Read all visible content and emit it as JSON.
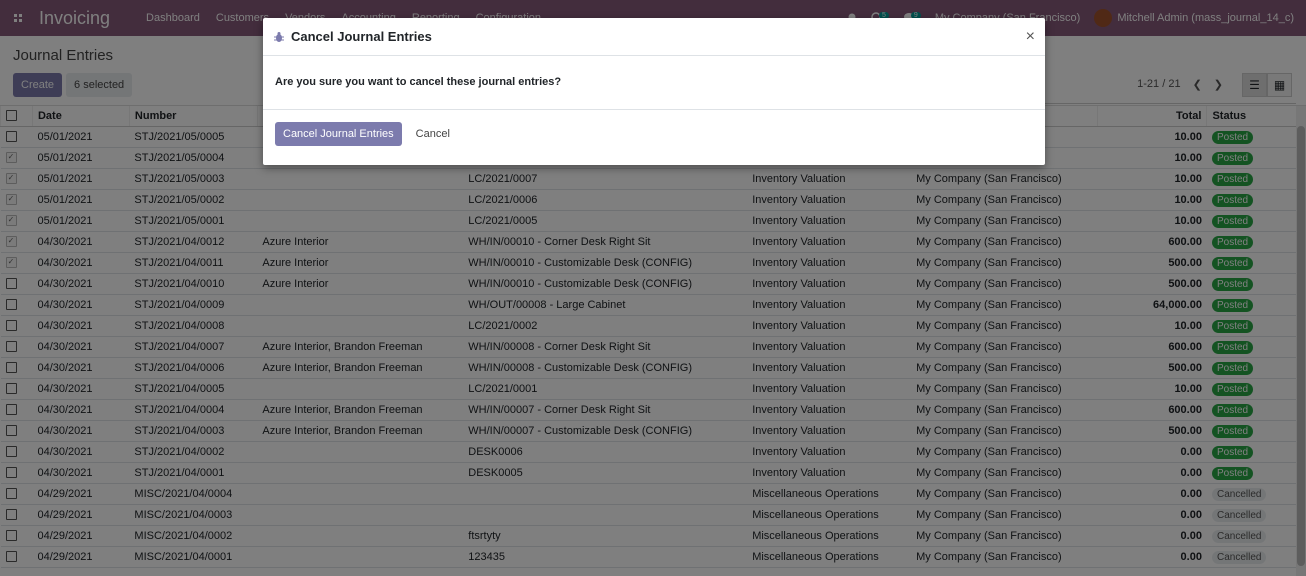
{
  "navbar": {
    "brand": "Invoicing",
    "menu": [
      "Dashboard",
      "Customers",
      "Vendors",
      "Accounting",
      "Reporting",
      "Configuration"
    ],
    "activity_count": "5",
    "messages_count": "9",
    "company": "My Company (San Francisco)",
    "user": "Mitchell Admin (mass_journal_14_c)"
  },
  "control_panel": {
    "title": "Journal Entries",
    "create_label": "Create",
    "selected_label": "6 selected",
    "pager": "1-21 / 21"
  },
  "table": {
    "headers": {
      "date": "Date",
      "number": "Number",
      "total": "Total",
      "status": "Status"
    },
    "rows": [
      {
        "checked": false,
        "date": "05/01/2021",
        "number": "STJ/2021/05/0005",
        "partner": "",
        "ref": "",
        "journal": "",
        "company": "",
        "total": "10.00",
        "status": "Posted"
      },
      {
        "checked": true,
        "date": "05/01/2021",
        "number": "STJ/2021/05/0004",
        "partner": "",
        "ref": "",
        "journal": "",
        "company": "",
        "total": "10.00",
        "status": "Posted"
      },
      {
        "checked": true,
        "date": "05/01/2021",
        "number": "STJ/2021/05/0003",
        "partner": "",
        "ref": "LC/2021/0007",
        "journal": "Inventory Valuation",
        "company": "My Company (San Francisco)",
        "total": "10.00",
        "status": "Posted"
      },
      {
        "checked": true,
        "date": "05/01/2021",
        "number": "STJ/2021/05/0002",
        "partner": "",
        "ref": "LC/2021/0006",
        "journal": "Inventory Valuation",
        "company": "My Company (San Francisco)",
        "total": "10.00",
        "status": "Posted"
      },
      {
        "checked": true,
        "date": "05/01/2021",
        "number": "STJ/2021/05/0001",
        "partner": "",
        "ref": "LC/2021/0005",
        "journal": "Inventory Valuation",
        "company": "My Company (San Francisco)",
        "total": "10.00",
        "status": "Posted"
      },
      {
        "checked": true,
        "date": "04/30/2021",
        "number": "STJ/2021/04/0012",
        "partner": "Azure Interior",
        "ref": "WH/IN/00010 - Corner Desk Right Sit",
        "journal": "Inventory Valuation",
        "company": "My Company (San Francisco)",
        "total": "600.00",
        "status": "Posted"
      },
      {
        "checked": true,
        "date": "04/30/2021",
        "number": "STJ/2021/04/0011",
        "partner": "Azure Interior",
        "ref": "WH/IN/00010 - Customizable Desk (CONFIG)",
        "journal": "Inventory Valuation",
        "company": "My Company (San Francisco)",
        "total": "500.00",
        "status": "Posted"
      },
      {
        "checked": false,
        "date": "04/30/2021",
        "number": "STJ/2021/04/0010",
        "partner": "Azure Interior",
        "ref": "WH/IN/00010 - Customizable Desk (CONFIG)",
        "journal": "Inventory Valuation",
        "company": "My Company (San Francisco)",
        "total": "500.00",
        "status": "Posted"
      },
      {
        "checked": false,
        "date": "04/30/2021",
        "number": "STJ/2021/04/0009",
        "partner": "",
        "ref": "WH/OUT/00008 - Large Cabinet",
        "journal": "Inventory Valuation",
        "company": "My Company (San Francisco)",
        "total": "64,000.00",
        "status": "Posted"
      },
      {
        "checked": false,
        "date": "04/30/2021",
        "number": "STJ/2021/04/0008",
        "partner": "",
        "ref": "LC/2021/0002",
        "journal": "Inventory Valuation",
        "company": "My Company (San Francisco)",
        "total": "10.00",
        "status": "Posted"
      },
      {
        "checked": false,
        "date": "04/30/2021",
        "number": "STJ/2021/04/0007",
        "partner": "Azure Interior, Brandon Freeman",
        "ref": "WH/IN/00008 - Corner Desk Right Sit",
        "journal": "Inventory Valuation",
        "company": "My Company (San Francisco)",
        "total": "600.00",
        "status": "Posted"
      },
      {
        "checked": false,
        "date": "04/30/2021",
        "number": "STJ/2021/04/0006",
        "partner": "Azure Interior, Brandon Freeman",
        "ref": "WH/IN/00008 - Customizable Desk (CONFIG)",
        "journal": "Inventory Valuation",
        "company": "My Company (San Francisco)",
        "total": "500.00",
        "status": "Posted"
      },
      {
        "checked": false,
        "date": "04/30/2021",
        "number": "STJ/2021/04/0005",
        "partner": "",
        "ref": "LC/2021/0001",
        "journal": "Inventory Valuation",
        "company": "My Company (San Francisco)",
        "total": "10.00",
        "status": "Posted"
      },
      {
        "checked": false,
        "date": "04/30/2021",
        "number": "STJ/2021/04/0004",
        "partner": "Azure Interior, Brandon Freeman",
        "ref": "WH/IN/00007 - Corner Desk Right Sit",
        "journal": "Inventory Valuation",
        "company": "My Company (San Francisco)",
        "total": "600.00",
        "status": "Posted"
      },
      {
        "checked": false,
        "date": "04/30/2021",
        "number": "STJ/2021/04/0003",
        "partner": "Azure Interior, Brandon Freeman",
        "ref": "WH/IN/00007 - Customizable Desk (CONFIG)",
        "journal": "Inventory Valuation",
        "company": "My Company (San Francisco)",
        "total": "500.00",
        "status": "Posted"
      },
      {
        "checked": false,
        "date": "04/30/2021",
        "number": "STJ/2021/04/0002",
        "partner": "",
        "ref": "DESK0006",
        "journal": "Inventory Valuation",
        "company": "My Company (San Francisco)",
        "total": "0.00",
        "status": "Posted"
      },
      {
        "checked": false,
        "date": "04/30/2021",
        "number": "STJ/2021/04/0001",
        "partner": "",
        "ref": "DESK0005",
        "journal": "Inventory Valuation",
        "company": "My Company (San Francisco)",
        "total": "0.00",
        "status": "Posted"
      },
      {
        "checked": false,
        "date": "04/29/2021",
        "number": "MISC/2021/04/0004",
        "partner": "",
        "ref": "",
        "journal": "Miscellaneous Operations",
        "company": "My Company (San Francisco)",
        "total": "0.00",
        "status": "Cancelled"
      },
      {
        "checked": false,
        "date": "04/29/2021",
        "number": "MISC/2021/04/0003",
        "partner": "",
        "ref": "",
        "journal": "Miscellaneous Operations",
        "company": "My Company (San Francisco)",
        "total": "0.00",
        "status": "Cancelled"
      },
      {
        "checked": false,
        "date": "04/29/2021",
        "number": "MISC/2021/04/0002",
        "partner": "",
        "ref": "ftsrtyty",
        "journal": "Miscellaneous Operations",
        "company": "My Company (San Francisco)",
        "total": "0.00",
        "status": "Cancelled"
      },
      {
        "checked": false,
        "date": "04/29/2021",
        "number": "MISC/2021/04/0001",
        "partner": "",
        "ref": "123435",
        "journal": "Miscellaneous Operations",
        "company": "My Company (San Francisco)",
        "total": "0.00",
        "status": "Cancelled"
      }
    ]
  },
  "modal": {
    "title": "Cancel Journal Entries",
    "close_symbol": "×",
    "body": "Are you sure you want to cancel these journal entries?",
    "confirm_label": "Cancel Journal Entries",
    "cancel_label": "Cancel"
  },
  "icons": {
    "apps": "apps-grid-icon",
    "search": "search-icon",
    "bug": "bug-icon",
    "list_view": "list-view-icon",
    "kanban_view": "kanban-view-icon"
  },
  "colors": {
    "navbar": "#875A7B",
    "primary": "#7C7BAD",
    "posted": "#28a745",
    "cancelled": "#e9ecef"
  }
}
